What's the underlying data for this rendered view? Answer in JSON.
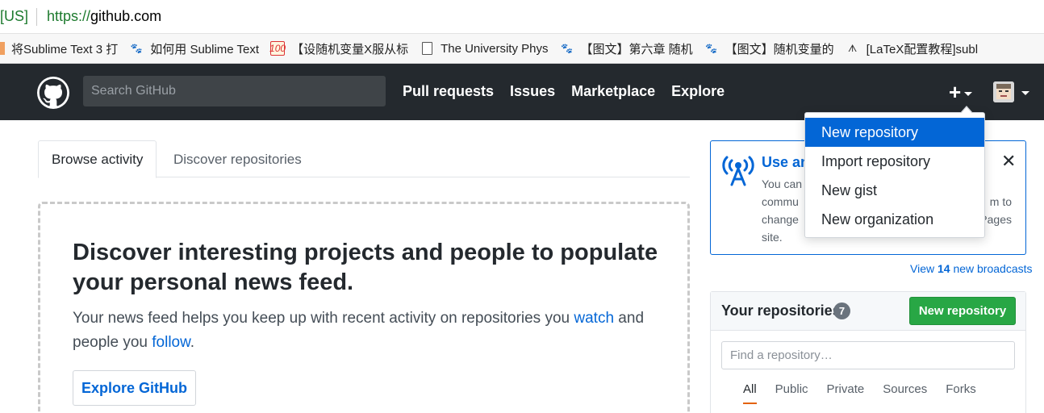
{
  "browser": {
    "address": {
      "ev_label": "[US]",
      "protocol": "https://",
      "host": "github.com"
    },
    "bookmarks": [
      {
        "icon": "page-icon",
        "label": "将Sublime Text 3 打"
      },
      {
        "icon": "baidu-paw-icon",
        "label": "如何用 Sublime Text"
      },
      {
        "icon": "score-100-icon",
        "label": "【设随机变量X服从标"
      },
      {
        "icon": "document-icon",
        "label": "The University Phys"
      },
      {
        "icon": "baidu-paw-icon",
        "label": "【图文】第六章 随机"
      },
      {
        "icon": "baidu-paw-icon",
        "label": "【图文】随机变量的"
      },
      {
        "icon": "fox-icon",
        "label": "[LaTeX配置教程]subl"
      }
    ]
  },
  "header": {
    "search_placeholder": "Search GitHub",
    "nav": [
      "Pull requests",
      "Issues",
      "Marketplace",
      "Explore"
    ],
    "plus": "+"
  },
  "tabs": {
    "active": "Browse activity",
    "inactive": "Discover repositories"
  },
  "discover": {
    "heading": "Discover interesting projects and people to populate your personal news feed.",
    "text_1": "Your news feed helps you keep up with recent activity on repositories you ",
    "link_watch": "watch",
    "text_2": " and people you ",
    "link_follow": "follow",
    "text_3": ".",
    "button": "Explore GitHub"
  },
  "broadcast": {
    "title": "Use an",
    "body": "You can commu change site.",
    "body_right_1": "m to",
    "body_right_2": "Pages",
    "view_prefix": "View ",
    "view_count": "14",
    "view_suffix": " new broadcasts"
  },
  "dropdown": {
    "items": [
      "New repository",
      "Import repository",
      "New gist",
      "New organization"
    ],
    "active_index": 0
  },
  "repositories": {
    "title": "Your repositories",
    "count": "7",
    "new_button": "New repository",
    "filter_placeholder": "Find a repository…",
    "filters": [
      "All",
      "Public",
      "Private",
      "Sources",
      "Forks"
    ],
    "active_filter": "All"
  },
  "colors": {
    "header_bg": "#24292e",
    "link": "#0366d6",
    "green_button": "#28a745",
    "active_tab_underline": "#e36209"
  }
}
